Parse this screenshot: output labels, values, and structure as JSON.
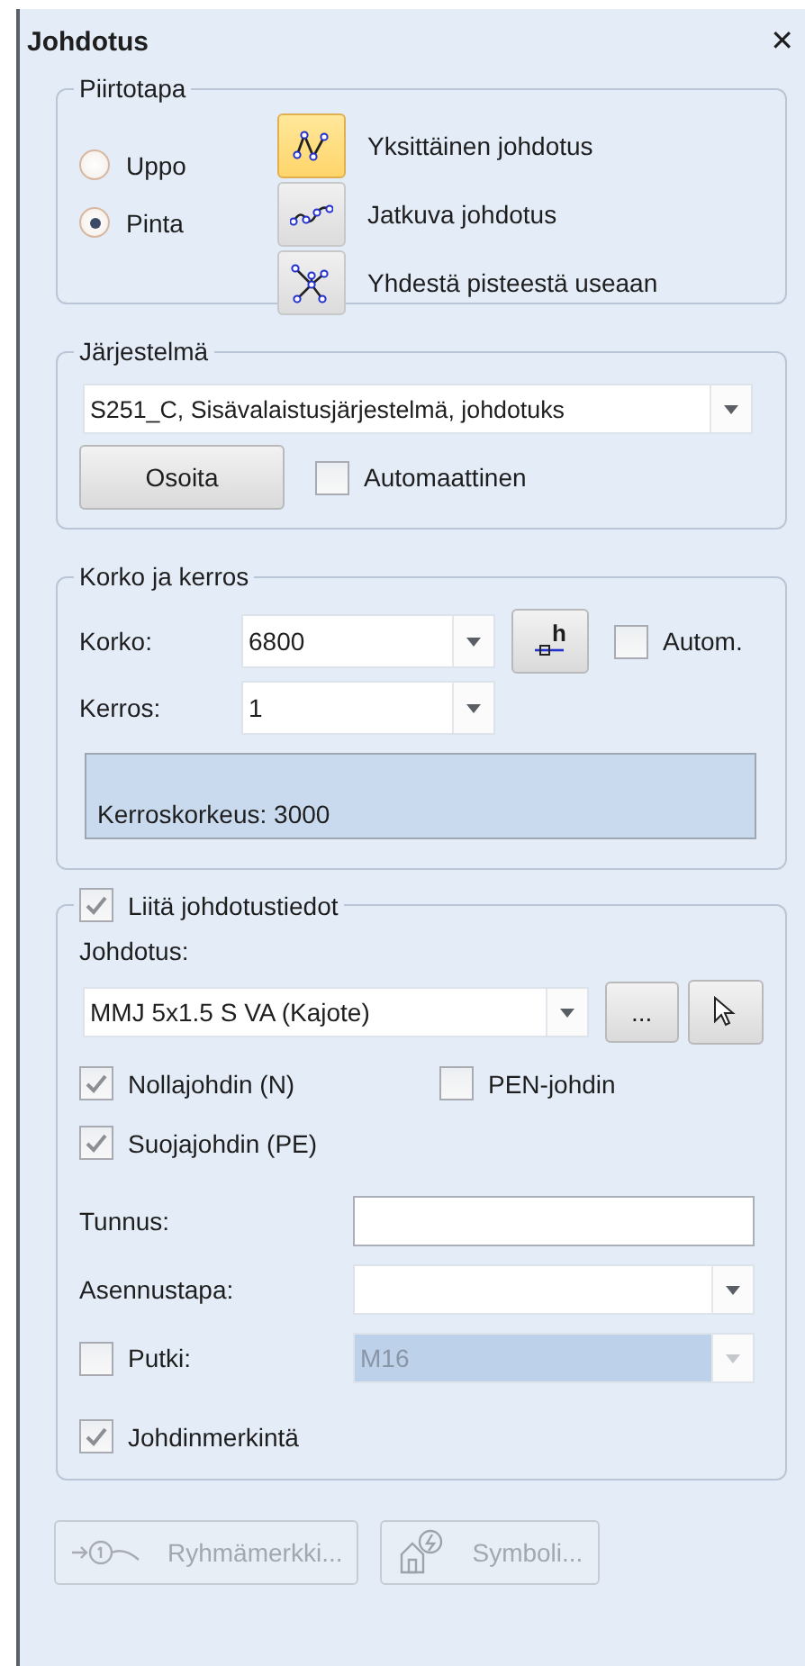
{
  "window": {
    "title": "Johdotus",
    "close": "✕"
  },
  "drawing_mode": {
    "title": "Piirtotapa",
    "radios": [
      {
        "label": "Uppo",
        "selected": false
      },
      {
        "label": "Pinta",
        "selected": true
      }
    ],
    "modes": [
      {
        "kind": "single",
        "label": "Yksittäinen johdotus",
        "selected": true
      },
      {
        "kind": "continuous",
        "label": "Jatkuva johdotus",
        "selected": false
      },
      {
        "kind": "star",
        "label": "Yhdestä pisteestä useaan",
        "selected": false
      }
    ]
  },
  "system": {
    "title": "Järjestelmä",
    "value": "S251_C, Sisävalaistusjärjestelmä, johdotuks",
    "assign_button": "Osoita",
    "automatic": {
      "label": "Automaattinen",
      "checked": false
    }
  },
  "height_floor": {
    "title": "Korko ja kerros",
    "height": {
      "label": "Korko:",
      "value": "6800"
    },
    "level_button": "h",
    "auto": {
      "label": "Autom.",
      "checked": false
    },
    "floor": {
      "label": "Kerros:",
      "value": "1"
    },
    "info": "Kerroskorkeus: 3000"
  },
  "cabling": {
    "attach": {
      "label": "Liitä johdotustiedot",
      "checked": true
    },
    "cable_label": "Johdotus:",
    "cable_value": "MMJ 5x1.5 S VA (Kajote)",
    "browse_button": "...",
    "conductors": [
      {
        "label": "Nollajohdin (N)",
        "checked": true
      },
      {
        "label": "PEN-johdin",
        "checked": false
      },
      {
        "label": "Suojajohdin (PE)",
        "checked": true
      }
    ],
    "id_label": "Tunnus:",
    "install_label": "Asennustapa:",
    "pipe": {
      "label": "Putki:",
      "checked": false,
      "value": "M16",
      "disabled": true
    },
    "marking": {
      "label": "Johdinmerkintä",
      "checked": true
    }
  },
  "footer_buttons": [
    {
      "kind": "group",
      "label": "Ryhmämerkki...",
      "disabled": true
    },
    {
      "kind": "symbol",
      "label": "Symboli...",
      "disabled": true
    }
  ]
}
